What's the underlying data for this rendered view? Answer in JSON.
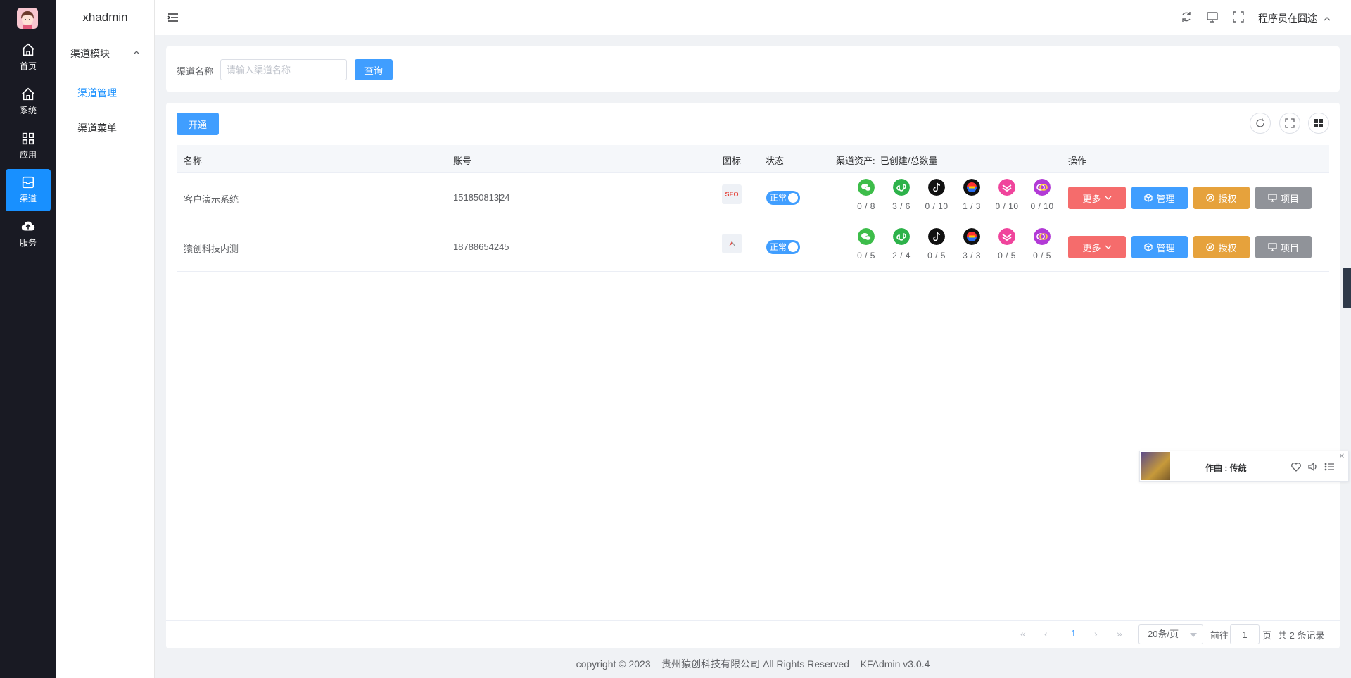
{
  "rail": {
    "items": [
      {
        "label": "首页",
        "icon": "home-icon"
      },
      {
        "label": "系统",
        "icon": "home-icon"
      },
      {
        "label": "应用",
        "icon": "grid-icon"
      },
      {
        "label": "渠道",
        "icon": "inbox-icon"
      },
      {
        "label": "服务",
        "icon": "cloud-upload-icon"
      }
    ],
    "active_index": 3
  },
  "submenu": {
    "brand": "xhadmin",
    "group": "渠道模块",
    "items": [
      "渠道管理",
      "渠道菜单"
    ]
  },
  "header": {
    "user": "程序员在囧途"
  },
  "search": {
    "label": "渠道名称",
    "placeholder": "请输入渠道名称",
    "button": "查询"
  },
  "toolbar": {
    "open_button": "开通"
  },
  "table": {
    "headers": {
      "name": "名称",
      "account": "账号",
      "logo": "图标",
      "status": "状态",
      "assets": "渠道资产:  已创建/总数量",
      "actions": "操作"
    },
    "asset_icons": [
      "wechat-icon",
      "mini-program-icon",
      "tiktok-icon",
      "kuaishou-icon",
      "qianniu-icon",
      "douyin-mall-icon"
    ],
    "rows": [
      {
        "name": "客户演示系统",
        "account": "151850813",
        "account_tail": "24",
        "logo": "SEO",
        "status": "正常",
        "assets": [
          "0 / 8",
          "3 / 6",
          "0 / 10",
          "1 / 3",
          "0 / 10",
          "0 / 10"
        ]
      },
      {
        "name": "猿创科技内测",
        "account": "18788654245",
        "account_tail": "",
        "logo": "",
        "status": "正常",
        "assets": [
          "0 / 5",
          "2 / 4",
          "0 / 5",
          "3 / 3",
          "0 / 5",
          "0 / 5"
        ]
      }
    ],
    "action_labels": {
      "more": "更多",
      "manage": "管理",
      "authorize": "授权",
      "project": "项目"
    }
  },
  "pagination": {
    "current": "1",
    "page_size": "20条/页",
    "goto_prefix": "前往",
    "goto_value": "1",
    "goto_suffix": "页",
    "total": "共 2 条记录"
  },
  "footer": {
    "text": "copyright © 2023    贵州猿创科技有限公司 All Rights Reserved    KFAdmin v3.0.4"
  },
  "music": {
    "title": "作曲 : 传统"
  },
  "colors": {
    "primary": "#409eff",
    "danger": "#f56c6c",
    "warning": "#e6a23c",
    "info": "#909399",
    "rail_bg": "#191a23",
    "rail_active": "#1890ff"
  }
}
